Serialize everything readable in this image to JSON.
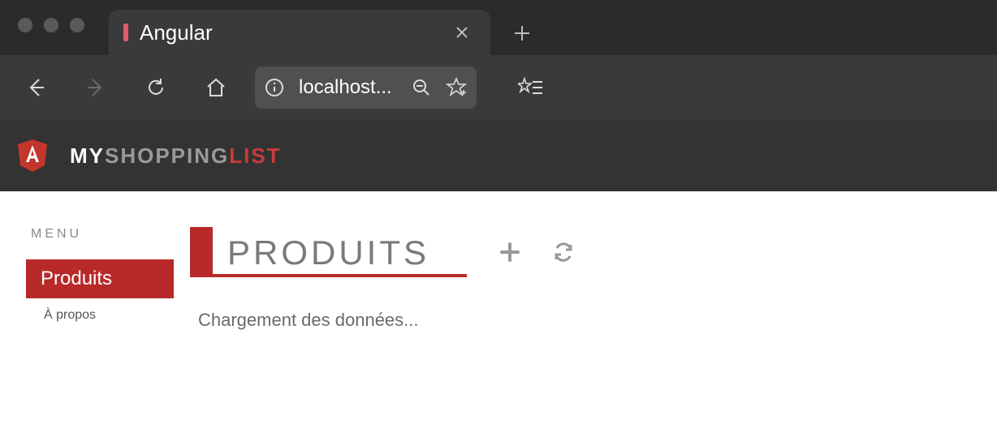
{
  "browser": {
    "tab_title": "Angular",
    "address": "localhost..."
  },
  "app": {
    "brand_my": "MY",
    "brand_shopping": "SHOPPING",
    "brand_list": "LIST"
  },
  "sidebar": {
    "menu_label": "MENU",
    "items": [
      {
        "label": "Produits"
      },
      {
        "label": "À propos"
      }
    ]
  },
  "main": {
    "title": "PRODUITS",
    "loading": "Chargement des données..."
  }
}
